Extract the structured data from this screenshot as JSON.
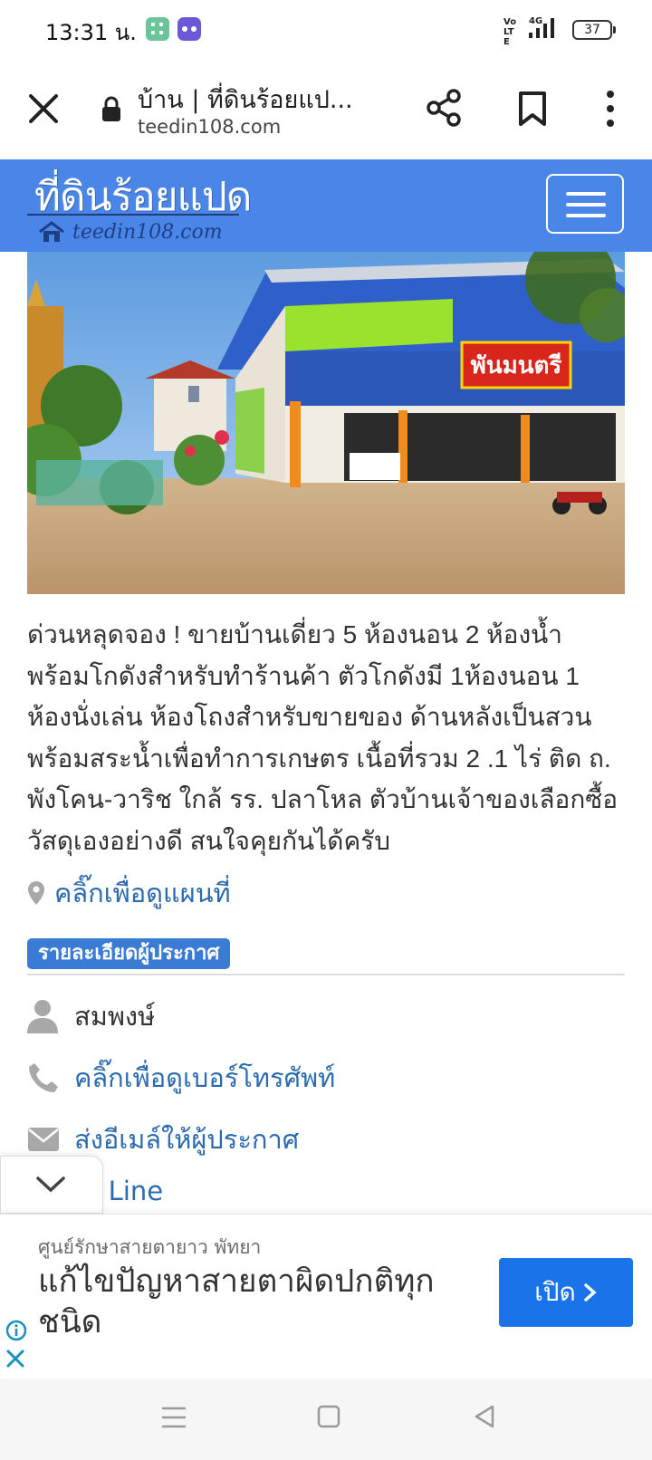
{
  "status_bar": {
    "time": "13:31 น.",
    "network_label": "4G",
    "volte_label": "Vo LTE",
    "battery": "37"
  },
  "browser": {
    "page_title": "บ้าน | ที่ดินร้อยแป...",
    "url": "teedin108.com"
  },
  "site": {
    "logo_text": "ที่ดินร้อยแปด",
    "logo_subtext": "teedin108.com",
    "brand_color": "#4a86e8"
  },
  "listing": {
    "sign_text": "พันมนตรี",
    "description": "ด่วนหลุดจอง ! ขายบ้านเดี่ยว 5 ห้องนอน 2 ห้องน้ำ พร้อมโกดังสำหรับทำร้านค้า ตัวโกดังมี 1ห้องนอน 1 ห้องนั่งเล่น ห้องโถงสำหรับขายของ ด้านหลังเป็นสวนพร้อมสระน้ำเพื่อทำการเกษตร เนื้อที่รวม 2 .1 ไร่ ติด ถ. พังโคน-วาริช ใกล้ รร. ปลาโหล ตัวบ้านเจ้าของเลือกซื้อวัสดุเองอย่างดี สนใจคุยกันได้ครับ",
    "map_link": "คลิ๊กเพื่อดูแผนที่"
  },
  "advertiser": {
    "section_label": "รายละเอียดผู้ประกาศ",
    "name": "สมพงษ์",
    "phone_link": "คลิ๊กเพื่อดูเบอร์โทรศัพท์",
    "email_link": "ส่งอีเมล์ให้ผู้ประกาศ",
    "line_link": "ld Line"
  },
  "ad": {
    "sponsor": "ศูนย์รักษาสายตายาว พัทยา",
    "headline": "แก้ไขปัญหาสายตาผิดปกติทุกชนิด",
    "button_label": "เปิด",
    "button_color": "#1a73e8"
  }
}
